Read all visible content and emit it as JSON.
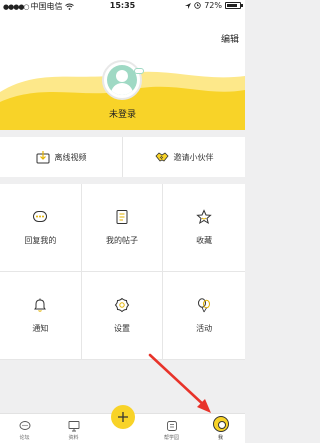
{
  "status_bar": {
    "carrier": "中国电信",
    "time": "15:35",
    "battery": "72%"
  },
  "header": {
    "edit_label": "编辑",
    "login_label": "未登录",
    "accent": "#f8d328"
  },
  "quick_actions": [
    {
      "label": "离线视频",
      "icon": "download-box-icon"
    },
    {
      "label": "邀请小伙伴",
      "icon": "handshake-icon"
    }
  ],
  "grid": [
    {
      "label": "回复我的",
      "icon": "chat-bubble-icon"
    },
    {
      "label": "我的帖子",
      "icon": "document-icon"
    },
    {
      "label": "收藏",
      "icon": "star-icon"
    },
    {
      "label": "通知",
      "icon": "bell-icon"
    },
    {
      "label": "设置",
      "icon": "settings-flower-icon"
    },
    {
      "label": "活动",
      "icon": "balloon-icon"
    }
  ],
  "tabbar": [
    {
      "label": "论坛",
      "icon": "chat-icon"
    },
    {
      "label": "资料",
      "icon": "monitor-icon"
    },
    {
      "label": "",
      "icon": "plus-icon"
    },
    {
      "label": "帮学园",
      "icon": "school-icon"
    },
    {
      "label": "我",
      "icon": "me-icon"
    }
  ],
  "colors": {
    "accent": "#f8d328",
    "annotation_arrow": "#e8332a"
  }
}
